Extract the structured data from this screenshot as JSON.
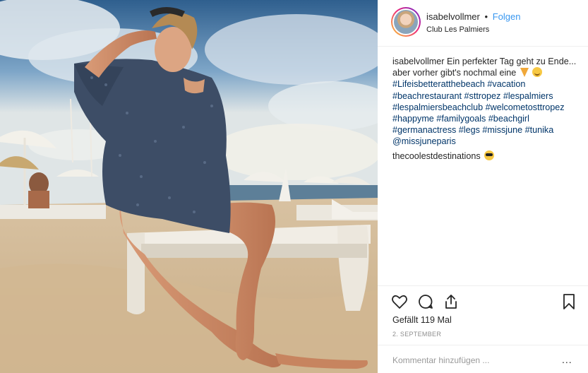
{
  "post": {
    "username": "isabelvollmer",
    "separator": "•",
    "follow_label": "Folgen",
    "location": "Club Les Palmiers",
    "caption_author": "isabelvollmer",
    "caption_text": "Ein perfekter Tag geht zu Ende... aber vorher gibt's nochmal eine",
    "hashtags": "#Lifeisbetteratthebeach #vacation #beachrestaurant #sttropez #lespalmiers #lespalmiersbeachclub #welcometosttropez #happyme #familygoals #beachgirl #germanactress #legs #missjune #tunika",
    "mention": "@missjuneparis",
    "comment_author": "thecoolestdestinations",
    "likes_text": "Gefällt 119 Mal",
    "date": "2. SEPTEMBER",
    "comment_placeholder": "Kommentar hinzufügen ...",
    "more_label": "..."
  },
  "icons": {
    "like": "heart-icon",
    "comment": "comment-bubble-icon",
    "share": "share-icon",
    "save": "bookmark-icon",
    "emoji_1": "pizza-emoji",
    "emoji_2": "smiling-face-emoji",
    "emoji_3": "sunglasses-face-emoji"
  },
  "colors": {
    "link": "#3897f0",
    "hashtag": "#003569",
    "muted": "#8e8e8e",
    "border": "#efefef"
  }
}
